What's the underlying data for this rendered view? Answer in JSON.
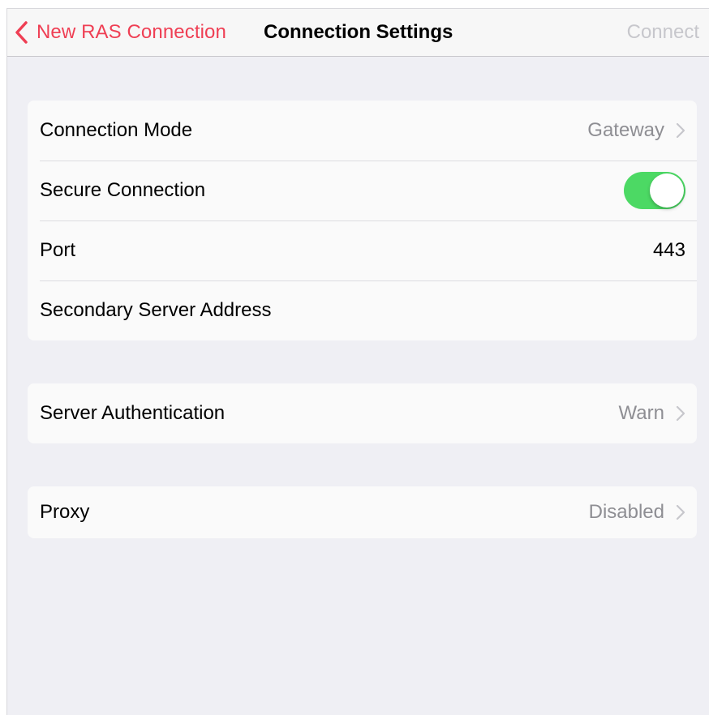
{
  "nav": {
    "back_label": "New RAS Connection",
    "title": "Connection Settings",
    "connect_label": "Connect"
  },
  "connection_group": {
    "mode_label": "Connection Mode",
    "mode_value": "Gateway",
    "secure_label": "Secure Connection",
    "secure_enabled": true,
    "port_label": "Port",
    "port_value": "443",
    "secondary_label": "Secondary Server Address",
    "secondary_value": ""
  },
  "auth_group": {
    "label": "Server Authentication",
    "value": "Warn"
  },
  "proxy_group": {
    "label": "Proxy",
    "value": "Disabled"
  },
  "colors": {
    "accent": "#ef3f54",
    "toggle_on": "#4cd964",
    "secondary_text": "#8e8e93",
    "disabled_text": "#c7c7cc",
    "background": "#efeff4"
  }
}
